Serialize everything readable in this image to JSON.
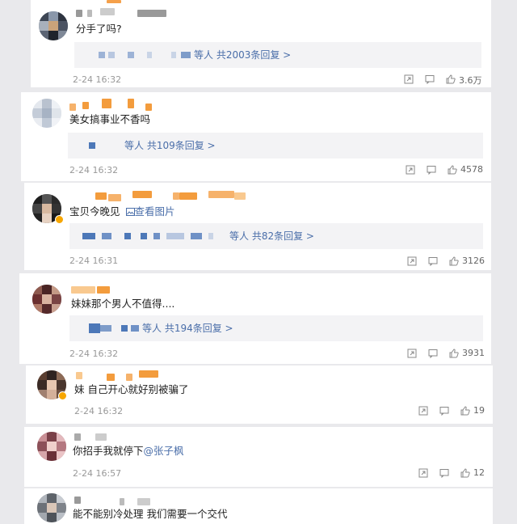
{
  "comments": [
    {
      "text": "分手了吗?",
      "reply_summary": "等人 共2003条回复 >",
      "time": "2-24 16:32",
      "likes": "3.6万"
    },
    {
      "text": "美女搞事业不香吗",
      "reply_summary": "等人 共109条回复 >",
      "time": "2-24 16:32",
      "likes": "4578"
    },
    {
      "text": "宝贝今晚见",
      "image_link": "查看图片",
      "reply_summary": "等人 共82条回复 >",
      "time": "2-24 16:31",
      "likes": "3126"
    },
    {
      "text": "妹妹那个男人不值得....",
      "reply_summary": "等人 共194条回复 >",
      "time": "2-24 16:32",
      "likes": "3931"
    },
    {
      "text": "妹 自己开心就好别被骗了",
      "time": "2-24 16:32",
      "likes": "19"
    },
    {
      "text": "你招手我就停下",
      "mention": "@张子枫",
      "time": "2-24 16:57",
      "likes": "12"
    },
    {
      "text": "能不能别冷处理 我们需要一个交代"
    }
  ],
  "icons": {
    "share": "share-icon",
    "comment": "comment-icon",
    "like": "thumbs-up-icon"
  },
  "colors": {
    "link": "#4a6ea9",
    "vip_orange": "#f7a600",
    "page_bg": "#e9e9ec"
  }
}
